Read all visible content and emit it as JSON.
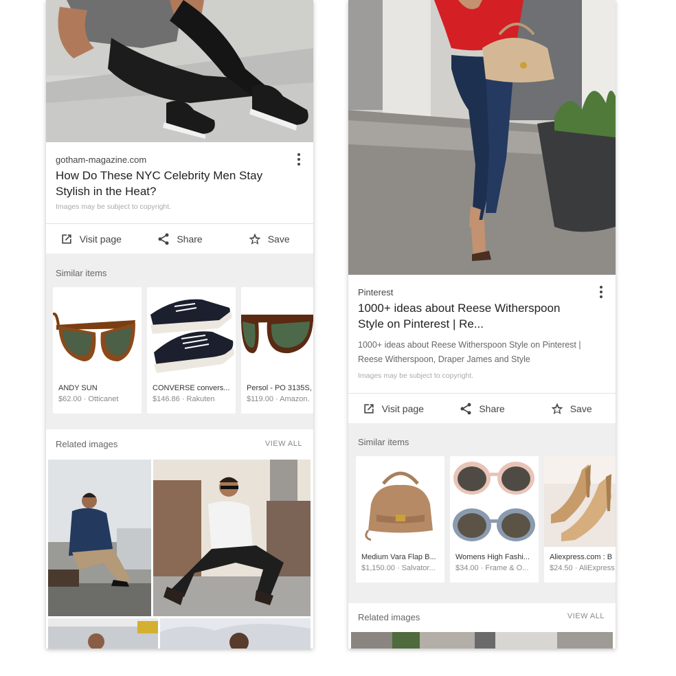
{
  "left": {
    "result": {
      "source": "gotham-magazine.com",
      "title": "How Do These NYC Celebrity Men Stay Stylish in the Heat?",
      "copyright": "Images may be subject to copyright."
    },
    "actions": [
      {
        "label": "Visit page",
        "icon": "open-external-icon"
      },
      {
        "label": "Share",
        "icon": "share-icon"
      },
      {
        "label": "Save",
        "icon": "star-icon"
      }
    ],
    "similar_label": "Similar items",
    "similar_items": [
      {
        "name": "ANDY SUN",
        "price": "$62.00 · Otticanet"
      },
      {
        "name": "CONVERSE convers...",
        "price": "$146.86 · Rakuten"
      },
      {
        "name": "Persol - PO 3135S,",
        "price": "$119.00 · Amazon."
      }
    ],
    "related_label": "Related images",
    "view_all": "VIEW ALL"
  },
  "right": {
    "result": {
      "source": "Pinterest",
      "title": "1000+ ideas about Reese Witherspoon Style on Pinterest | Re...",
      "description": "1000+ ideas about Reese Witherspoon Style on Pinterest | Reese Witherspoon, Draper James and Style",
      "copyright": "Images may be subject to copyright."
    },
    "actions": [
      {
        "label": "Visit page",
        "icon": "open-external-icon"
      },
      {
        "label": "Share",
        "icon": "share-icon"
      },
      {
        "label": "Save",
        "icon": "star-icon"
      }
    ],
    "similar_label": "Similar items",
    "similar_items": [
      {
        "name": "Medium Vara Flap B...",
        "price": "$1,150.00 · Salvator..."
      },
      {
        "name": "Womens High Fashi...",
        "price": "$34.00 · Frame & O..."
      },
      {
        "name": "Aliexpress.com : B",
        "price": "$24.50 · AliExpress"
      }
    ],
    "related_label": "Related images",
    "view_all": "VIEW ALL"
  },
  "colors": {
    "panel_bg": "#efefef",
    "card_bg": "#ffffff",
    "text": "#222222",
    "muted": "#888888"
  }
}
